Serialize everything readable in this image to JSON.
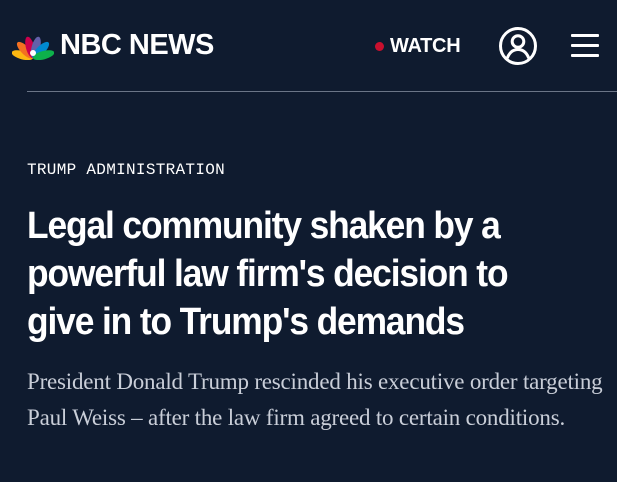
{
  "header": {
    "logo_text": "NBC NEWS",
    "watch_label": "WATCH",
    "live_dot_color": "#c8102e",
    "account_icon": "user-circle-icon",
    "menu_icon": "hamburger-menu-icon"
  },
  "article": {
    "category": "TRUMP ADMINISTRATION",
    "headline": "Legal community shaken by a powerful law firm's decision to give in to Trump's demands",
    "dek": "President Donald Trump rescinded his executive order targeting Paul Weiss – after the law firm agreed to certain conditions."
  },
  "colors": {
    "background": "#0f1b2f",
    "text": "#ffffff",
    "dek_text": "#c9ced8",
    "divider": "#6b7587"
  }
}
